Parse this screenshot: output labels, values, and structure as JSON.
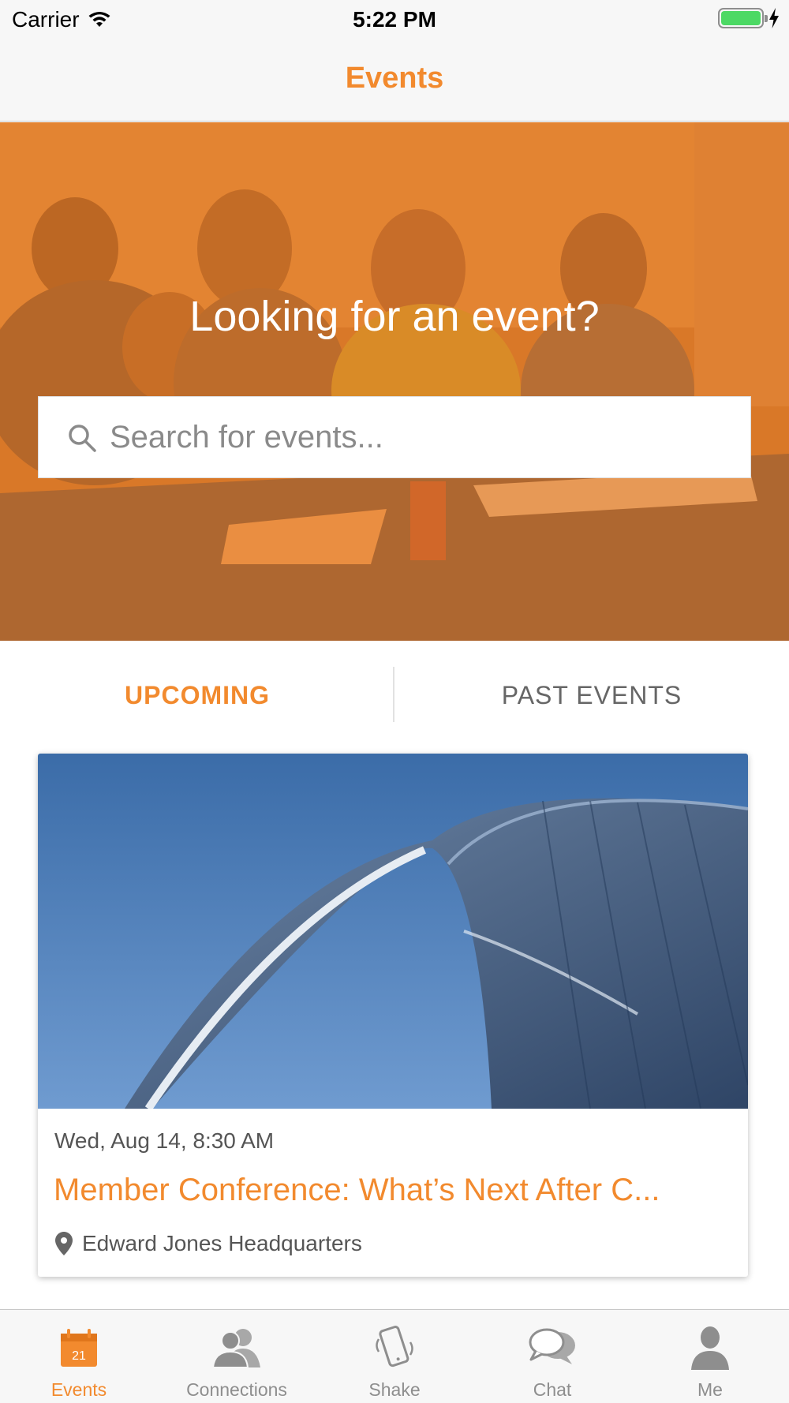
{
  "status_bar": {
    "carrier": "Carrier",
    "time": "5:22 PM",
    "battery_level": 1.0,
    "charging": true
  },
  "nav": {
    "title": "Events"
  },
  "hero": {
    "title": "Looking for an event?",
    "search_placeholder": "Search for events...",
    "search_value": ""
  },
  "tabs": {
    "upcoming": "UPCOMING",
    "past": "PAST EVENTS",
    "selected": "upcoming"
  },
  "events": [
    {
      "date": "Wed, Aug 14, 8:30 AM",
      "title": "Member Conference: What’s Next After C...",
      "location": "Edward Jones Headquarters"
    }
  ],
  "tab_bar": {
    "items": [
      {
        "label": "Events",
        "icon": "calendar-icon",
        "badge_day": "21",
        "active": true
      },
      {
        "label": "Connections",
        "icon": "people-icon",
        "active": false
      },
      {
        "label": "Shake",
        "icon": "phone-shake-icon",
        "active": false
      },
      {
        "label": "Chat",
        "icon": "chat-bubbles-icon",
        "active": false
      },
      {
        "label": "Me",
        "icon": "person-icon",
        "active": false
      }
    ]
  },
  "colors": {
    "accent": "#f28a2e",
    "inactive": "#8e8e8e",
    "battery": "#4cd964"
  }
}
